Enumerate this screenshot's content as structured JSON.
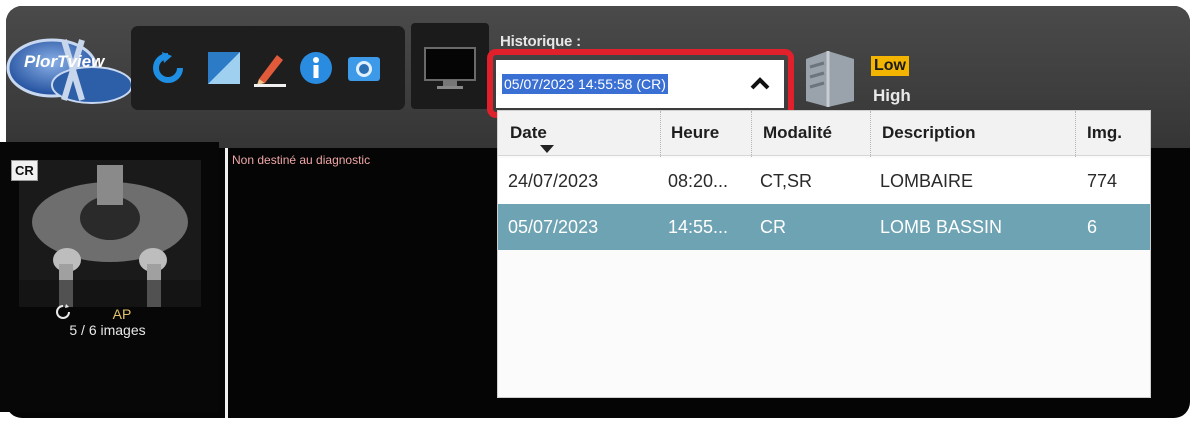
{
  "toolbar": {
    "logo_text": "PlorTview",
    "tools": [
      "rotate-icon",
      "image-adjust-icon",
      "pencil-icon",
      "info-icon",
      "camera-icon"
    ],
    "monitor_icon": "monitor-icon"
  },
  "history": {
    "label": "Historique :",
    "selected": "05/07/2023 14:55:58 (CR)",
    "caret_icon": "chevron-up-icon",
    "highlight_color": "#e0202a"
  },
  "quality": {
    "low": "Low",
    "high": "High",
    "low_color": "#f3b500"
  },
  "series": {
    "modality_badge": "CR",
    "description": "AP",
    "count": "5 / 6 images"
  },
  "viewport": {
    "warning": "Non destiné au diagnostic"
  },
  "table": {
    "columns": [
      "Date",
      "Heure",
      "Modalité",
      "Description",
      "Img."
    ],
    "sorted_column": "Date",
    "rows": [
      {
        "date": "24/07/2023",
        "time": "08:20...",
        "modality": "CT,SR",
        "description": "LOMBAIRE",
        "images": "774",
        "selected": false
      },
      {
        "date": "05/07/2023",
        "time": "14:55...",
        "modality": "CR",
        "description": "LOMB BASSIN",
        "images": "6",
        "selected": true
      }
    ],
    "selected_row_color": "#6ea3b3"
  }
}
